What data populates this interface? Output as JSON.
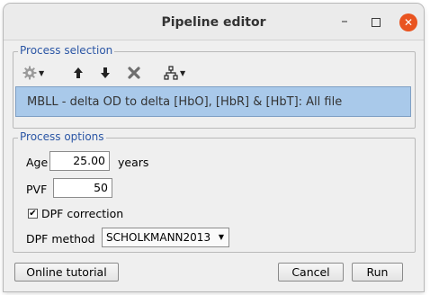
{
  "window": {
    "title": "Pipeline editor",
    "controls": {
      "minimize": "–",
      "close": "✕"
    }
  },
  "process_selection": {
    "legend": "Process selection",
    "toolbar": [
      {
        "name": "settings-dropdown",
        "icon": "gear-icon"
      },
      {
        "name": "move-up",
        "icon": "arrow-up-icon"
      },
      {
        "name": "move-down",
        "icon": "arrow-down-icon"
      },
      {
        "name": "delete",
        "icon": "close-x-icon"
      },
      {
        "name": "pipeline-dropdown",
        "icon": "hierarchy-icon"
      }
    ],
    "selected_process": "MBLL - delta OD to delta [HbO], [HbR] & [HbT]: All file"
  },
  "process_options": {
    "legend": "Process options",
    "age": {
      "label": "Age",
      "value": "25.00",
      "unit": "years"
    },
    "pvf": {
      "label": "PVF",
      "value": "50"
    },
    "dpf_correction": {
      "label": "DPF correction",
      "checked": true,
      "mark": "✔"
    },
    "dpf_method": {
      "label": "DPF method",
      "selected": "SCHOLKMANN2013"
    }
  },
  "buttons": {
    "tutorial": "Online tutorial",
    "cancel": "Cancel",
    "run": "Run"
  },
  "colors": {
    "accent": "#2b56a5",
    "selection_bg": "#a9c9ea",
    "close_button": "#e95420"
  }
}
